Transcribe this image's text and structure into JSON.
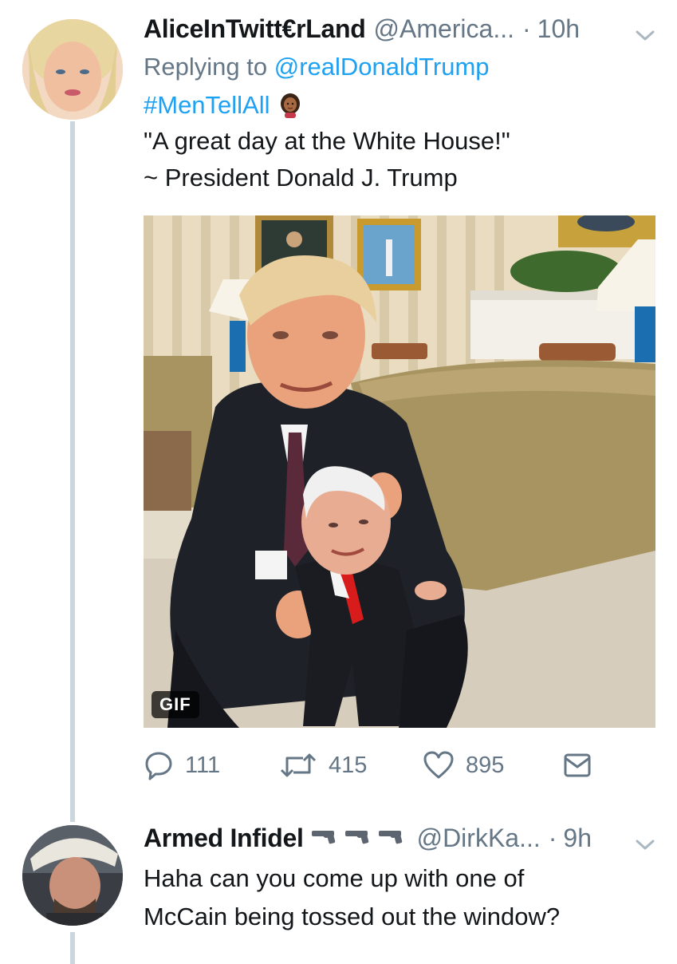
{
  "tweet1": {
    "display_name": "AliceInTwitt€rLand",
    "handle": "@America...",
    "separator": "·",
    "time": "10h",
    "replying_label": "Replying to",
    "replying_mention": "@realDonaldTrump",
    "hashtag": "#MenTellAll",
    "quote_line1": "\"A great day at the White House!\"",
    "quote_line2": "~ President Donald J. Trump",
    "media_badge": "GIF"
  },
  "actions": {
    "replies": "111",
    "retweets": "415",
    "likes": "895"
  },
  "tweet2": {
    "display_name": "Armed Infidel",
    "handle": "@DirkKa...",
    "separator": "·",
    "time": "9h",
    "text_line1": "Haha can you come up with one of",
    "text_line2": "McCain being tossed out the window?"
  },
  "icons": {
    "reply": "reply-icon",
    "retweet": "retweet-icon",
    "like": "heart-icon",
    "dm": "envelope-icon",
    "caret": "chevron-down-icon",
    "hashtag_emoji": "woman-emoji-icon",
    "guns": "revolver-emoji-icon"
  },
  "colors": {
    "link": "#1da1f2",
    "secondary": "#657786",
    "thread_line": "#ccd6dd"
  }
}
